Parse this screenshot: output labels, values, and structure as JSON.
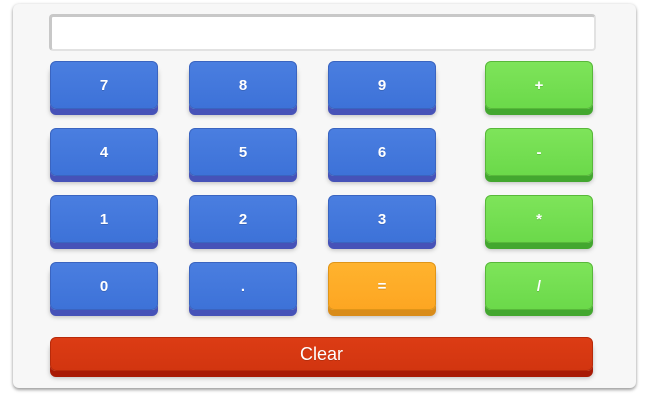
{
  "display": {
    "value": ""
  },
  "keys": {
    "seven": "7",
    "eight": "8",
    "nine": "9",
    "plus": "+",
    "four": "4",
    "five": "5",
    "six": "6",
    "minus": "-",
    "one": "1",
    "two": "2",
    "three": "3",
    "multiply": "*",
    "zero": "0",
    "dot": ".",
    "equals": "=",
    "divide": "/"
  },
  "clear_label": "Clear",
  "colors": {
    "number_key": "#3d72d8",
    "operator_key": "#6bd94a",
    "equals_key": "#fda622",
    "clear_key": "#d23510"
  }
}
